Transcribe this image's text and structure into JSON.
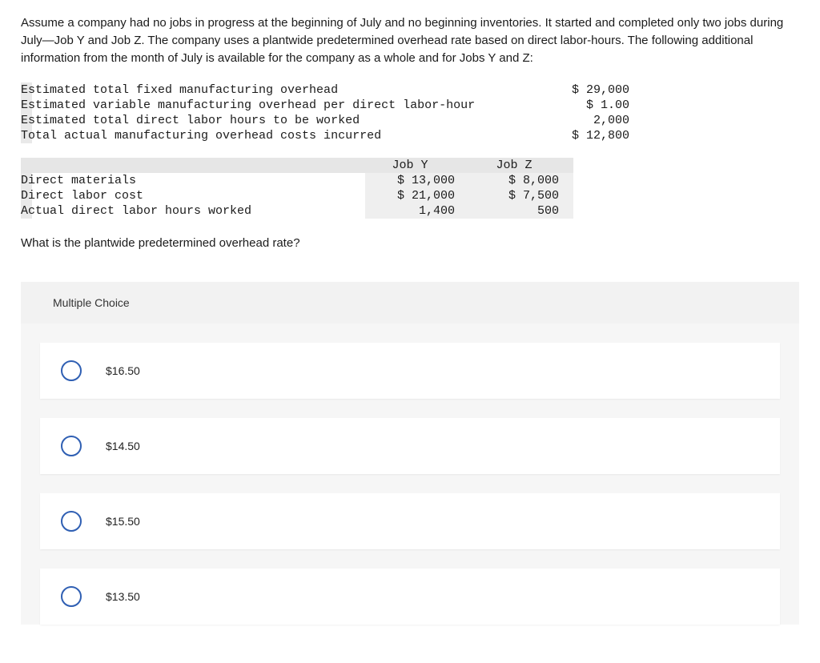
{
  "intro": "Assume a company had no jobs in progress at the beginning of July and no beginning inventories. It started and completed only two jobs during July—Job Y and Job Z. The company uses a plantwide predetermined overhead rate based on direct labor-hours. The following additional information from the month of July is available for the company as a whole and for Jobs Y and Z:",
  "info_rows": [
    {
      "label": "Estimated total fixed manufacturing overhead",
      "value": "$ 29,000"
    },
    {
      "label": "Estimated variable manufacturing overhead per direct labor-hour",
      "value": "$ 1.00"
    },
    {
      "label": "Estimated total direct labor hours to be worked",
      "value": "2,000"
    },
    {
      "label": "Total actual manufacturing overhead costs incurred",
      "value": "$ 12,800"
    }
  ],
  "job_table": {
    "headers": {
      "c1": "Job Y",
      "c2": "Job Z"
    },
    "rows": [
      {
        "label": "Direct materials",
        "y": "$ 13,000",
        "z": "$ 8,000"
      },
      {
        "label": "Direct labor cost",
        "y": "$ 21,000",
        "z": "$ 7,500"
      },
      {
        "label": "Actual direct labor hours worked",
        "y": "1,400",
        "z": "500"
      }
    ]
  },
  "question": "What is the plantwide predetermined overhead rate?",
  "mc_label": "Multiple Choice",
  "choices": [
    "$16.50",
    "$14.50",
    "$15.50",
    "$13.50"
  ]
}
